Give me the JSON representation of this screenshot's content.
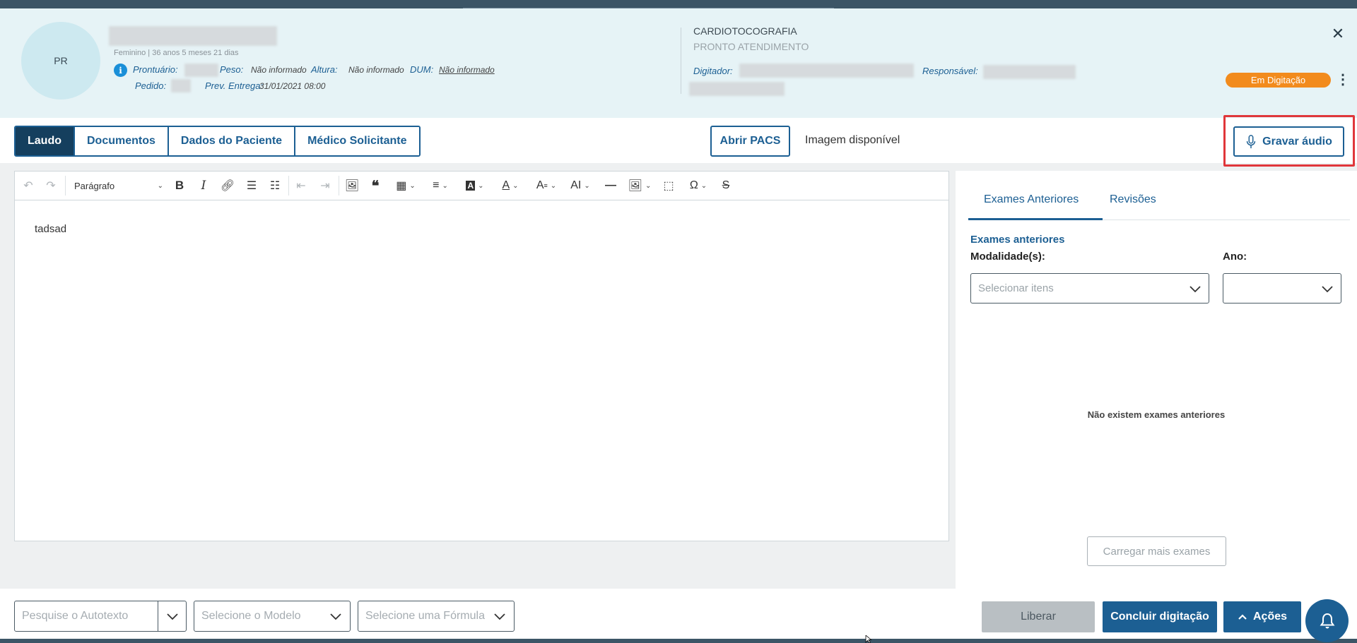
{
  "patient": {
    "initials": "PR",
    "demographics": "Feminino | 36 anos 5 meses 21 dias",
    "prontuario_label": "Prontuário:",
    "peso_label": "Peso:",
    "peso_value": "Não informado",
    "altura_label": "Altura:",
    "altura_value": "Não informado",
    "dum_label": "DUM:",
    "dum_value": "Não informado",
    "pedido_label": "Pedido:",
    "entrega_label": "Prev. Entrega:",
    "entrega_value": "31/01/2021 08:00"
  },
  "exam": {
    "title": "CARDIOTOCOGRAFIA",
    "subtitle": "PRONTO ATENDIMENTO",
    "digitador_label": "Digitador:",
    "responsavel_label": "Responsável:",
    "status": "Em Digitação",
    "status_color": "#f28b1d"
  },
  "tabs": [
    {
      "label": "Laudo",
      "active": true
    },
    {
      "label": "Documentos",
      "active": false
    },
    {
      "label": "Dados do Paciente",
      "active": false
    },
    {
      "label": "Médico Solicitante",
      "active": false
    }
  ],
  "actions": {
    "pacs_label": "Abrir PACS",
    "image_status": "Imagem disponível",
    "audio_label": "Gravar áudio"
  },
  "editor": {
    "paragraph_style": "Parágrafo",
    "content": "tadsad"
  },
  "right_panel": {
    "tabs": [
      "Exames Anteriores",
      "Revisões"
    ],
    "section_title": "Exames anteriores",
    "modalidade_label": "Modalidade(s):",
    "modalidade_placeholder": "Selecionar itens",
    "ano_label": "Ano:",
    "ano_value": "",
    "empty_message": "Não existem exames anteriores",
    "load_more_label": "Carregar mais exames"
  },
  "footer": {
    "autotexto_placeholder": "Pesquise o Autotexto",
    "modelo_placeholder": "Selecione o Modelo",
    "formula_placeholder": "Selecione uma Fórmula",
    "liberar_label": "Liberar",
    "concluir_label": "Concluir digitação",
    "acoes_label": "Ações"
  },
  "colors": {
    "primary": "#1c5f93",
    "primary_dark": "#153f5e",
    "highlight": "#e0363a",
    "header_bg": "#e6f3f6"
  }
}
